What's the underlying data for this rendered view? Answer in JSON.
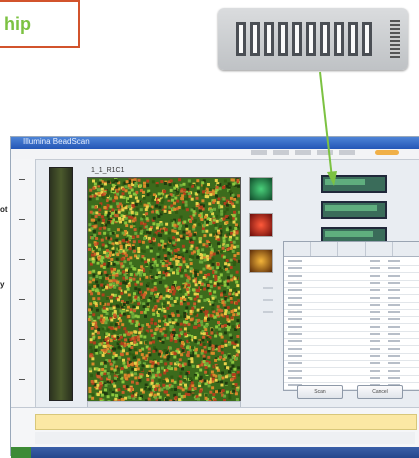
{
  "chip_label": "hip",
  "side_labels": [
    "ot",
    "y"
  ],
  "app": {
    "title": "Illumina BeadScan",
    "scan_header": "1_1_R1C1",
    "buttons": [
      "Scan",
      "Cancel"
    ]
  },
  "colors": {
    "chip_border": "#d2532c",
    "chip_text": "#7cc242",
    "arrow": "#7cc242",
    "channel_green": "#3a6c5a"
  },
  "icons": [
    "chip-photo",
    "scan-image",
    "thumb-green",
    "thumb-red",
    "thumb-yellow"
  ]
}
